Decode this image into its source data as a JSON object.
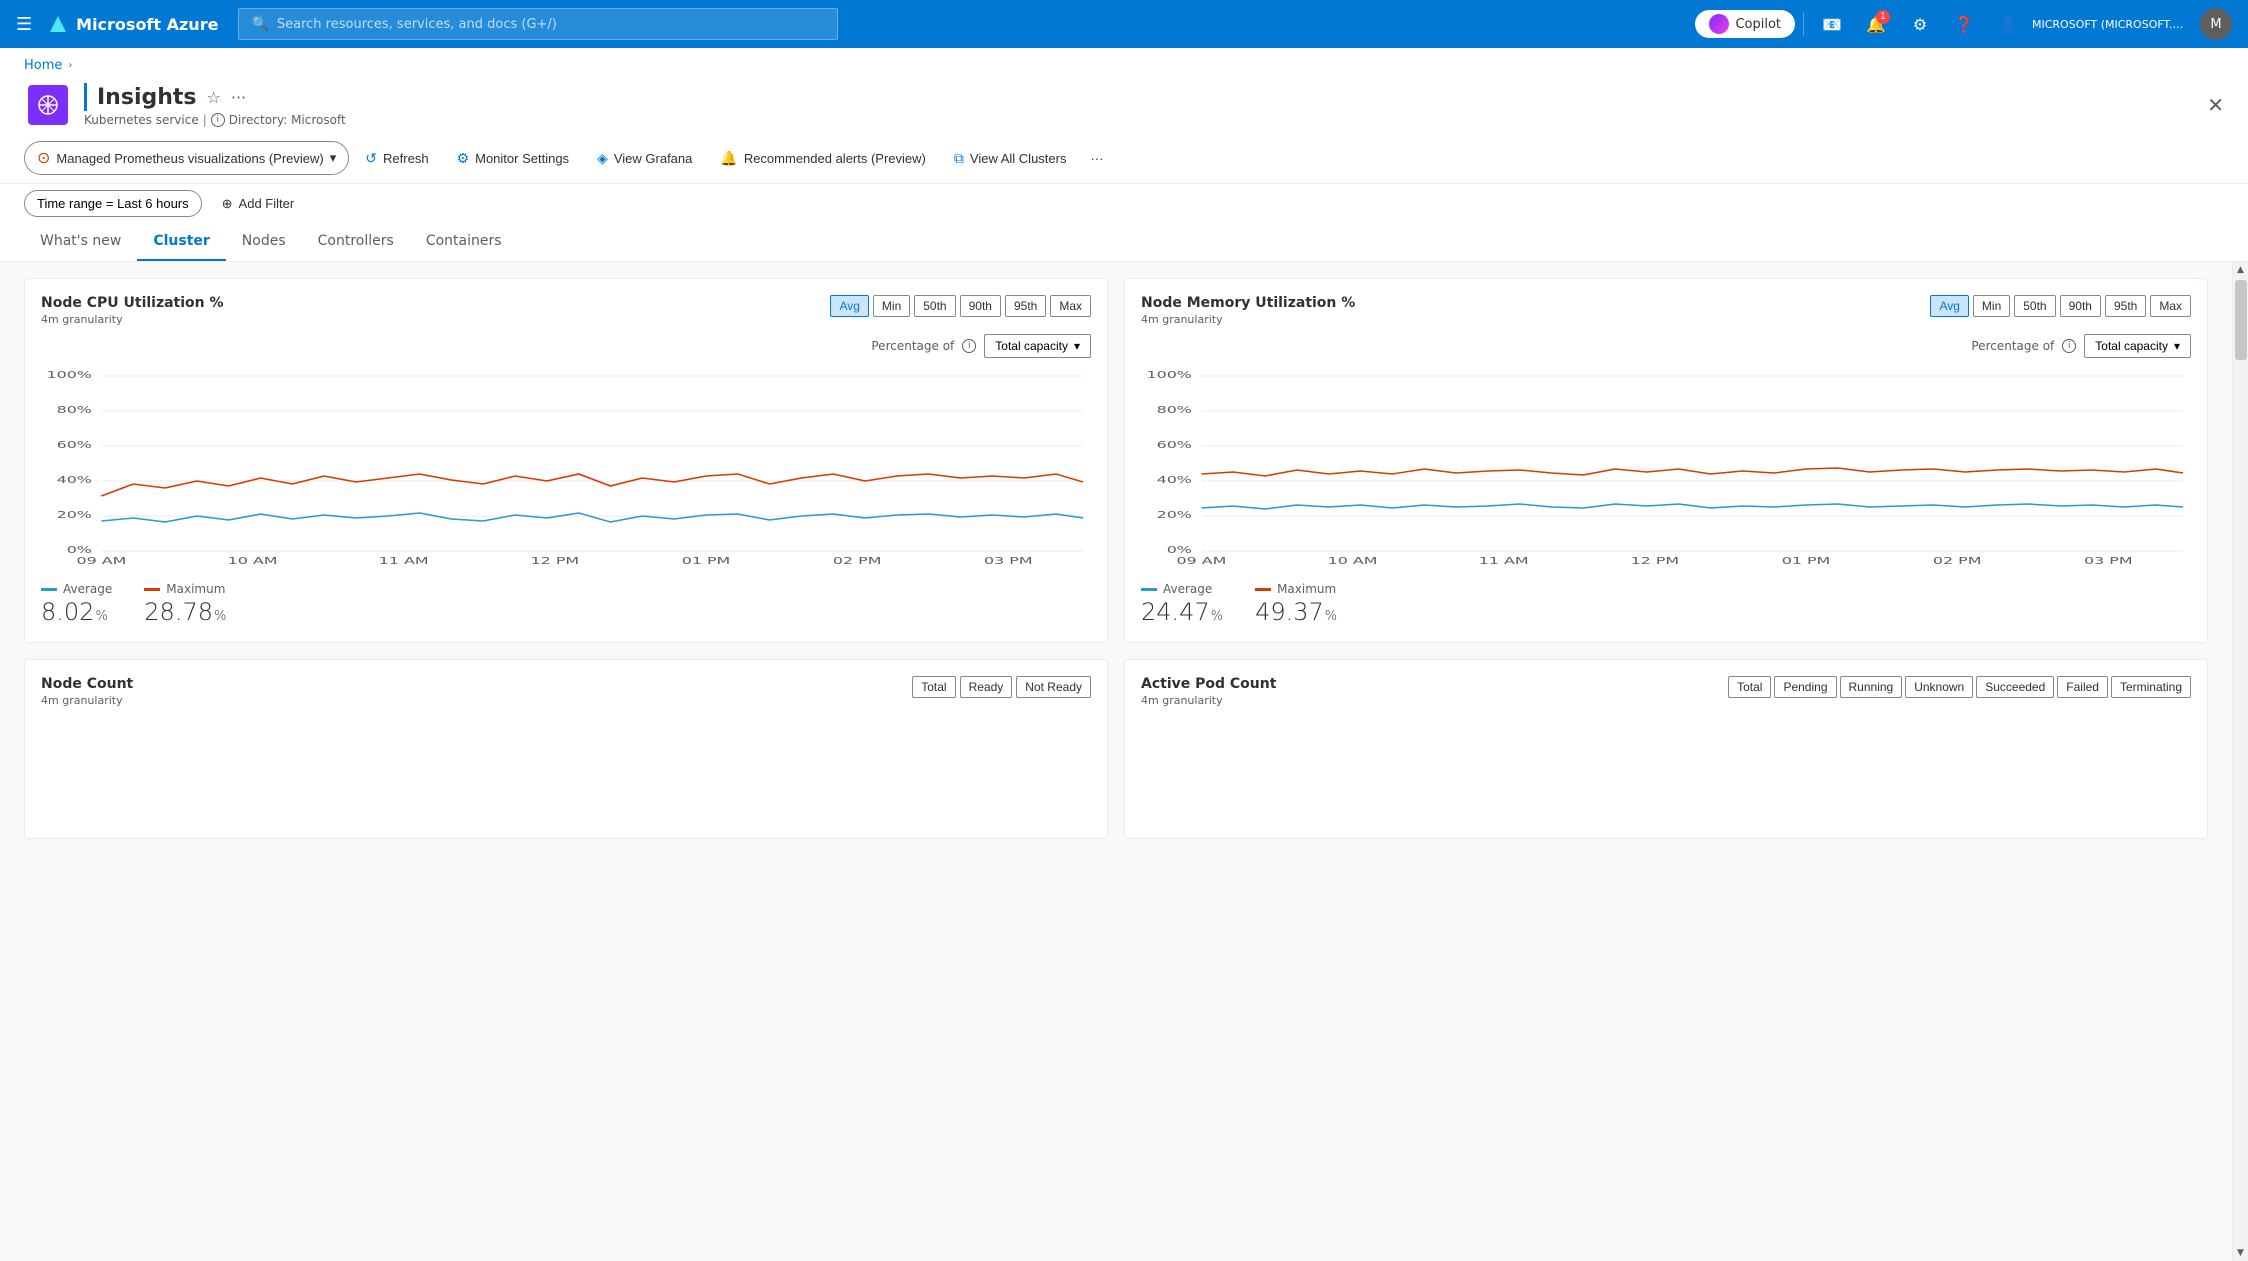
{
  "nav": {
    "hamburger": "☰",
    "logo": "Microsoft Azure",
    "search_placeholder": "Search resources, services, and docs (G+/)",
    "copilot_label": "Copilot",
    "notification_count": "1",
    "account_text": "MICROSOFT (MICROSOFT.ONMI..."
  },
  "breadcrumb": {
    "home": "Home",
    "sep": "›"
  },
  "page": {
    "title": "Insights",
    "subtitle": "Kubernetes service",
    "directory": "Directory: Microsoft"
  },
  "toolbar": {
    "prometheus_label": "Managed Prometheus visualizations (Preview)",
    "refresh_label": "Refresh",
    "monitor_settings_label": "Monitor Settings",
    "view_grafana_label": "View Grafana",
    "recommended_alerts_label": "Recommended alerts (Preview)",
    "view_all_clusters_label": "View All Clusters"
  },
  "filter": {
    "time_range_label": "Time range = Last 6 hours",
    "add_filter_label": "Add Filter"
  },
  "tabs": [
    {
      "id": "whats-new",
      "label": "What's new"
    },
    {
      "id": "cluster",
      "label": "Cluster",
      "active": true
    },
    {
      "id": "nodes",
      "label": "Nodes"
    },
    {
      "id": "controllers",
      "label": "Controllers"
    },
    {
      "id": "containers",
      "label": "Containers"
    }
  ],
  "cpu_chart": {
    "title": "Node CPU Utilization %",
    "granularity": "4m granularity",
    "controls": [
      "Avg",
      "Min",
      "50th",
      "90th",
      "95th",
      "Max"
    ],
    "active_control": "Avg",
    "percentage_of_label": "Percentage of",
    "capacity_label": "Total capacity",
    "x_labels": [
      "09 AM",
      "10 AM",
      "11 AM",
      "12 PM",
      "01 PM",
      "02 PM",
      "03 PM"
    ],
    "y_labels": [
      "100%",
      "80%",
      "60%",
      "40%",
      "20%",
      "0%"
    ],
    "avg_label": "Average",
    "max_label": "Maximum",
    "avg_value": "8.02",
    "max_value": "28.78",
    "unit": "%"
  },
  "memory_chart": {
    "title": "Node Memory Utilization %",
    "granularity": "4m granularity",
    "controls": [
      "Avg",
      "Min",
      "50th",
      "90th",
      "95th",
      "Max"
    ],
    "active_control": "Avg",
    "percentage_of_label": "Percentage of",
    "capacity_label": "Total capacity",
    "x_labels": [
      "09 AM",
      "10 AM",
      "11 AM",
      "12 PM",
      "01 PM",
      "02 PM",
      "03 PM"
    ],
    "y_labels": [
      "100%",
      "80%",
      "60%",
      "40%",
      "20%",
      "0%"
    ],
    "avg_label": "Average",
    "max_label": "Maximum",
    "avg_value": "24.47",
    "max_value": "49.37",
    "unit": "%"
  },
  "node_count_chart": {
    "title": "Node Count",
    "granularity": "4m granularity",
    "controls": [
      "Total",
      "Ready",
      "Not Ready"
    ]
  },
  "pod_count_chart": {
    "title": "Active Pod Count",
    "granularity": "4m granularity",
    "controls": [
      "Total",
      "Pending",
      "Running",
      "Unknown",
      "Succeeded",
      "Failed",
      "Terminating"
    ]
  }
}
